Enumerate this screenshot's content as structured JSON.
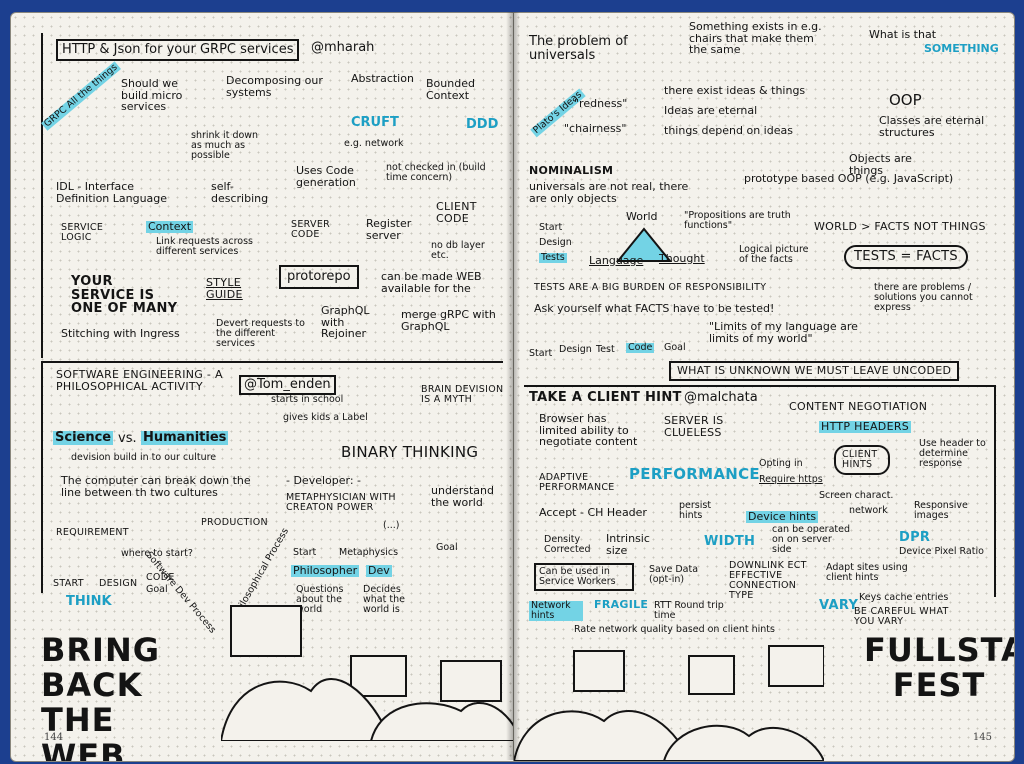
{
  "left": {
    "s1": {
      "title": "HTTP & Json for your GRPC services",
      "handle": "@mharah",
      "grpc": "GRPC All the things",
      "microservices": "Should we build micro services",
      "decomposing": "Decomposing our systems",
      "abstraction": "Abstraction",
      "bounded_context": "Bounded Context",
      "ddd": "DDD",
      "cruft": "CRUFT",
      "network": "e.g. network",
      "shrink": "shrink it down as much as possible",
      "idl": "IDL - Interface Definition Language",
      "self_describing": "self-describing",
      "uses_code": "Uses Code generation",
      "not_checked": "not checked in (build time concern)",
      "service_logic": "SERVICE LOGIC",
      "context": "Context",
      "link_requests": "Link requests across different services",
      "server_code": "SERVER CODE",
      "register_server": "Register server",
      "client_code": "CLIENT CODE",
      "no_db": "no db layer etc.",
      "your_service": "YOUR SERVICE IS ONE OF MANY",
      "style_guide": "STYLE GUIDE",
      "protorepo": "protorepo",
      "web": "can be made WEB available for the",
      "graphql": "GraphQL with Rejoiner",
      "merge": "merge gRPC with GraphQL",
      "ingress": "Stitching with Ingress",
      "devert": "Devert requests to the different services"
    },
    "s2": {
      "title": "SOFTWARE ENGINEERING - A philosophical activity",
      "handle": "@Tom_enden",
      "science": "Science",
      "vs": "vs.",
      "humanities": "Humanities",
      "division": "devision build in to our culture",
      "school": "starts in school",
      "kids_label": "gives kids a Label",
      "brain": "BRAIN DEVISION IS A MYTH",
      "binary": "BINARY THINKING",
      "computer": "The computer can break down the line between th two cultures",
      "developer": "- Developer: -",
      "metaphysician": "METAPHYSICIAN WITH CREATON POWER",
      "understand": "understand the world",
      "requirement": "REQUIREMENT",
      "production": "PRODUCTION",
      "where": "where to start?",
      "flow": [
        "START",
        "DESIGN",
        "CODE",
        "Goal"
      ],
      "think": "THINK",
      "process": "Software Dev Process",
      "phil_process": "Philosophical Process",
      "phil_flow": [
        "Start",
        "Metaphysics",
        "(...)",
        "Goal"
      ],
      "philosopher": "Philosopher",
      "dev": "Dev",
      "questions": "Questions about the world",
      "decides": "Decides what the world is"
    },
    "bring_back": "BRING BACK THE WEB",
    "page_number": "144"
  },
  "right": {
    "s1": {
      "problem": "The problem of universals",
      "something_exists": "Something exists in e.g. chairs that make them the same",
      "what_is": "What is that",
      "something": "SOMETHING",
      "platos": "Plato's Ideas",
      "redness": "\"redness\"",
      "chairness": "\"chairness\"",
      "ideas_things": "there exist ideas & things",
      "ideas_eternal": "Ideas are eternal",
      "depend": "things depend on ideas",
      "oop": "OOP",
      "classes": "Classes are eternal structures",
      "objects": "Objects are things",
      "nominalism": "NOMINALISM",
      "universals": "universals are not real, there are only objects",
      "prototype": "prototype based OOP (e.g. JavaScript)",
      "flow": [
        "Start",
        "Design",
        "Tests"
      ],
      "world": "World",
      "language": "Language",
      "thought": "Thought",
      "propositions": "\"Propositions are truth functions\"",
      "logical": "Logical picture of the facts",
      "world_facts": "WORLD > FACTS not THINGS",
      "tests_facts": "TESTS = FACTS",
      "burden": "TESTS ARE A BIG BURDEN OF RESPONSIBILITY",
      "ask": "Ask yourself what FACTS have to be tested!",
      "problems": "there are problems / solutions you cannot express",
      "flow2": [
        "Start",
        "Design",
        "Test",
        "Code",
        "Goal"
      ],
      "limits": "\"Limits of my language are limits of my world\"",
      "unknown": "WHAT IS UNKNOWN WE MUST LEAVE UNCODED"
    },
    "s2": {
      "title": "TAKE A CLIENT HINT",
      "handle": "@malchata",
      "browser": "Browser has limited ability to negotiate content",
      "clueless": "SERVER IS CLUELESS",
      "negotiation": "CONTENT NEGOTIATION",
      "http_headers": "HTTP HEADERS",
      "client_hints": "CLIENT HINTS",
      "use_header": "Use header to determine response",
      "adaptive": "ADAPTIVE PERFORMANCE",
      "performance": "PERFORMANCE",
      "opting": "Opting in",
      "requirehttps": "Require https",
      "screen": "Screen charact.",
      "network": "network",
      "responsive": "Responsive images",
      "accept": "Accept - CH Header",
      "persist": "persist hints",
      "device_hints": "Device hints",
      "density": "Density Corrected",
      "intrinsic": "Intrinsic size",
      "width": "WIDTH",
      "operated": "can be operated on on server side",
      "dpr": "DPR",
      "dpr_full": "Device Pixel Ratio",
      "service_workers": "Can be used in Service Workers",
      "save_data": "Save Data (opt-in)",
      "downlink": "DOWNLINK ECT Effective Connection Type",
      "adapt": "Adapt sites using client hints",
      "network_hints": "Network hints",
      "fragile": "FRAGILE",
      "rtt": "RTT Round trip time",
      "vary": "VARY",
      "keys": "Keys cache entries",
      "careful": "BE CAREFUL WHAT YOU VARY",
      "rate": "Rate network quality based on client hints"
    },
    "fullstack": "FULLSTACK FEST",
    "page_number": "145"
  },
  "colors": {
    "accent": "#73d3e5",
    "accent_text": "#1d9fc4",
    "ink": "#141414",
    "paper": "#f4f2ec",
    "background": "#1c3f8f"
  }
}
